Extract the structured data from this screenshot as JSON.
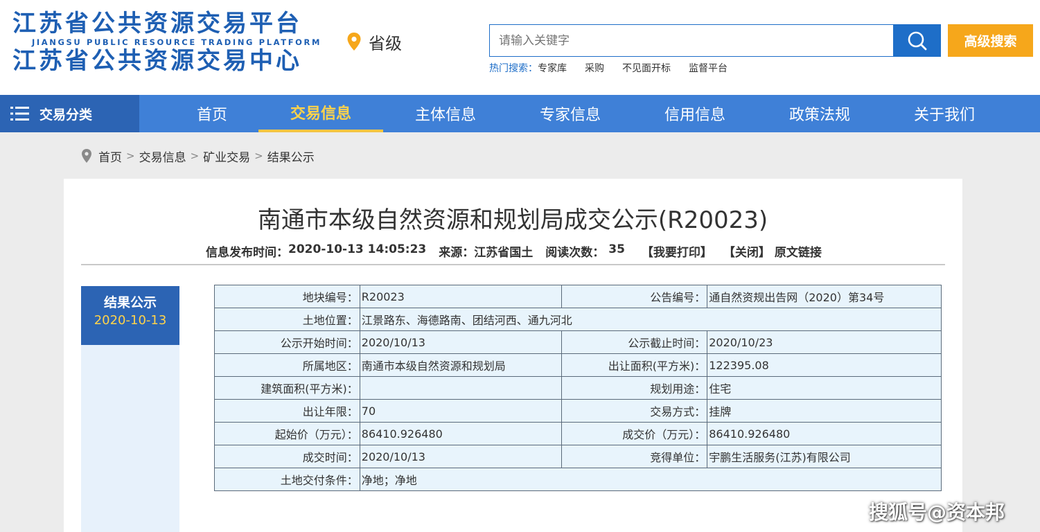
{
  "header": {
    "logo_line1": "江苏省公共资源交易平台",
    "logo_line2": "JIANGSU PUBLIC RESOURCE TRADING PLATFORM",
    "logo_line3": "江苏省公共资源交易中心",
    "location": "省级",
    "search_placeholder": "请输入关键字",
    "advanced_search": "高级搜索",
    "hot_label": "热门搜索：",
    "hot_items": [
      "专家库",
      "采购",
      "不见面开标",
      "监督平台"
    ]
  },
  "nav": {
    "category": "交易分类",
    "items": [
      "首页",
      "交易信息",
      "主体信息",
      "专家信息",
      "信用信息",
      "政策法规",
      "关于我们"
    ],
    "active": "交易信息"
  },
  "breadcrumb": [
    "首页",
    "交易信息",
    "矿业交易",
    "结果公示"
  ],
  "article": {
    "title": "南通市本级自然资源和规划局成交公示(R20023)",
    "publish_label": "信息发布时间：",
    "publish_time": "2020-10-13 14:05:23",
    "source_label": "来源：",
    "source": "江苏省国土",
    "views_label": "阅读次数：",
    "views": "35",
    "print": "【我要打印】",
    "close": "【关闭】",
    "original": "原文链接"
  },
  "side": {
    "title": "结果公示",
    "date": "2020-10-13"
  },
  "table": {
    "rows": [
      {
        "l1": "地块编号：",
        "v1": "R20023",
        "l2": "公告编号：",
        "v2": "通自然资规出告网（2020）第34号"
      },
      {
        "l1": "土地位置：",
        "v1": "江景路东、海德路南、团结河西、通九河北",
        "l2": null,
        "v2": null
      },
      {
        "l1": "公示开始时间：",
        "v1": "2020/10/13",
        "l2": "公示截止时间：",
        "v2": "2020/10/23"
      },
      {
        "l1": "所属地区：",
        "v1": "南通市本级自然资源和规划局",
        "l2": "出让面积(平方米)：",
        "v2": "122395.08"
      },
      {
        "l1": "建筑面积(平方米)：",
        "v1": "",
        "l2": "规划用途：",
        "v2": "住宅"
      },
      {
        "l1": "出让年限：",
        "v1": "70",
        "l2": "交易方式：",
        "v2": "挂牌"
      },
      {
        "l1": "起始价（万元）：",
        "v1": "86410.926480",
        "l2": "成交价（万元）：",
        "v2": "86410.926480"
      },
      {
        "l1": "成交时间：",
        "v1": "2020/10/13",
        "l2": "竞得单位：",
        "v2": "宇鹏生活服务(江苏)有限公司"
      },
      {
        "l1": "土地交付条件：",
        "v1": "净地；净地",
        "l2": null,
        "v2": null
      }
    ]
  },
  "watermark": "搜狐号@资本邦",
  "colors": {
    "brand_blue": "#1e5fb3",
    "nav_blue": "#3f80d7",
    "nav_dark": "#2c64b4",
    "accent_orange": "#f6a71b",
    "active_yellow": "#ffd34a",
    "table_bg": "#e8f4fc"
  }
}
